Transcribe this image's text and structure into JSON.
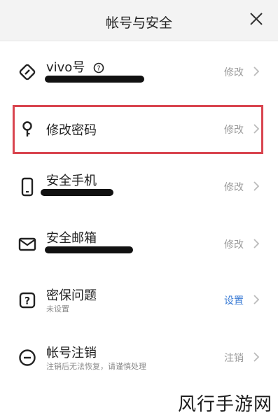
{
  "header": {
    "title": "帐号与安全",
    "close_icon": "close-icon"
  },
  "rows": [
    {
      "label": "vivo号",
      "action": "修改",
      "icon": "tag-icon"
    },
    {
      "label": "修改密码",
      "action": "修改",
      "icon": "key-icon"
    },
    {
      "label": "安全手机",
      "action": "修改",
      "icon": "phone-icon"
    },
    {
      "label": "安全邮箱",
      "action": "修改",
      "icon": "mail-icon"
    },
    {
      "label": "密保问题",
      "sub": "未设置",
      "action": "设置",
      "icon": "question-icon"
    },
    {
      "label": "帐号注销",
      "sub": "注销后无法恢复，请谨慎处理",
      "action": "注销",
      "icon": "minus-circle-icon"
    }
  ],
  "colors": {
    "highlight": "#d9454f",
    "link_blue": "#3a7bd5",
    "action_gray": "#9a9a9a"
  },
  "watermark": "风行手游网"
}
